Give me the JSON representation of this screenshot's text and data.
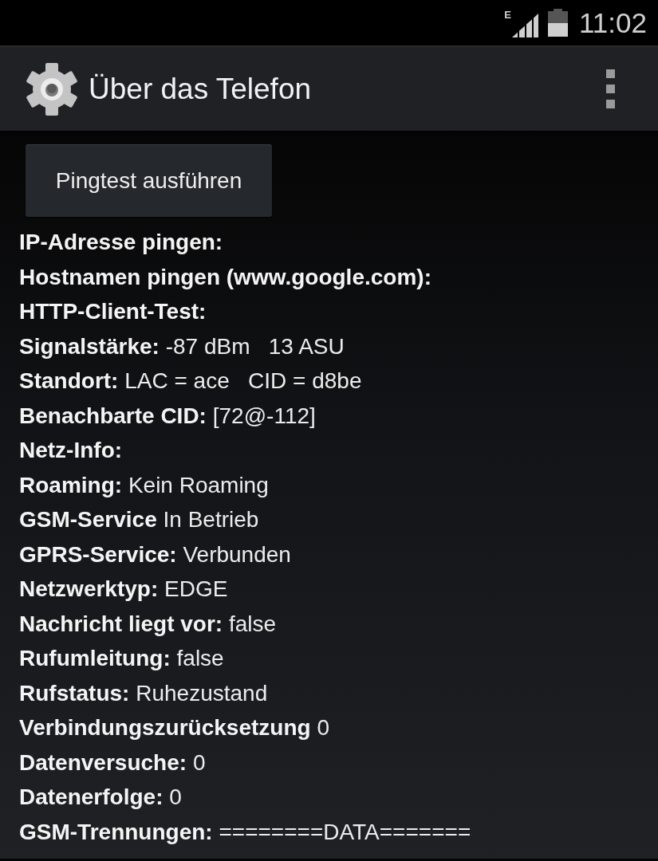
{
  "status_bar": {
    "network_type": "E",
    "time": "11:02"
  },
  "action_bar": {
    "title": "Über das Telefon"
  },
  "ping_button": {
    "label": "Pingtest ausführen"
  },
  "info_rows": [
    {
      "label": "IP-Adresse pingen:"
    },
    {
      "label": "Hostnamen pingen (www.google.com):"
    },
    {
      "label": "HTTP-Client-Test:"
    },
    {
      "label": "Signalstärke:",
      "value": "-87 dBm   13 ASU"
    },
    {
      "label": "Standort:",
      "value": "LAC = ace   CID = d8be"
    },
    {
      "label": "Benachbarte CID:",
      "value": "[72@-112]"
    },
    {
      "label": "Netz-Info:"
    },
    {
      "label": "Roaming:",
      "value": "Kein Roaming"
    },
    {
      "label": "GSM-Service",
      "value": "In Betrieb"
    },
    {
      "label": "GPRS-Service:",
      "value": "Verbunden"
    },
    {
      "label": "Netzwerktyp:",
      "value": "EDGE"
    },
    {
      "label": "Nachricht liegt vor:",
      "value": "false"
    },
    {
      "label": "Rufumleitung:",
      "value": "false"
    },
    {
      "label": "Rufstatus:",
      "value": "Ruhezustand"
    },
    {
      "label": "Verbindungszurücksetzung",
      "value": "0"
    },
    {
      "label": "Datenversuche:",
      "value": "0"
    },
    {
      "label": "Datenerfolge:",
      "value": "0"
    },
    {
      "label": "GSM-Trennungen:",
      "value": "========DATA======="
    }
  ]
}
